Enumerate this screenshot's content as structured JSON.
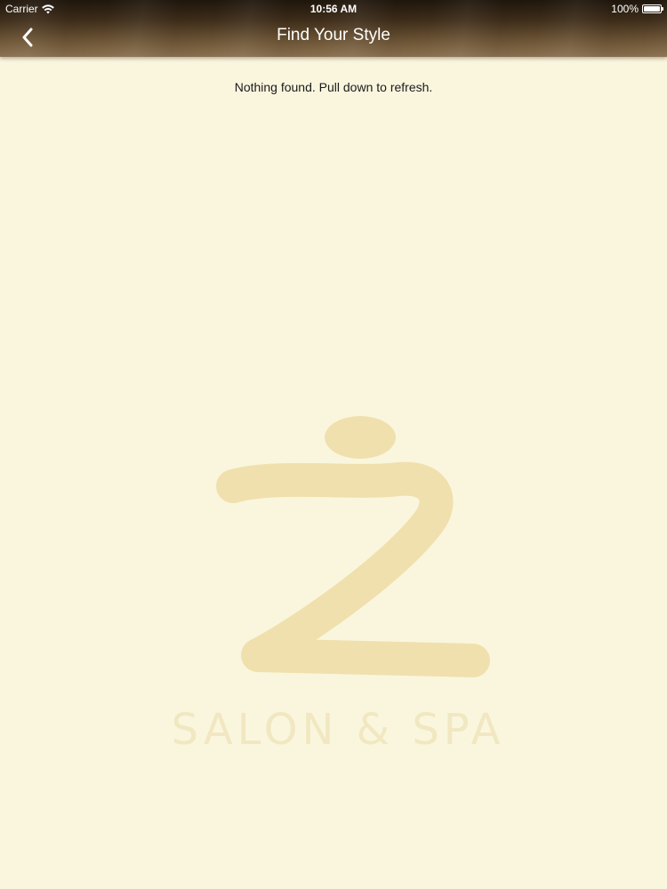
{
  "status_bar": {
    "carrier": "Carrier",
    "time": "10:56 AM",
    "battery": "100%",
    "battery_level": 1.0
  },
  "nav": {
    "title": "Find Your Style",
    "back_icon": "chevron-left-icon"
  },
  "content": {
    "empty_message": "Nothing found. Pull down to refresh."
  },
  "watermark": {
    "text": "SALON & SPA"
  },
  "colors": {
    "background": "#faf6de",
    "navbar": "#5a4428",
    "logo": "#f0e0ad"
  }
}
